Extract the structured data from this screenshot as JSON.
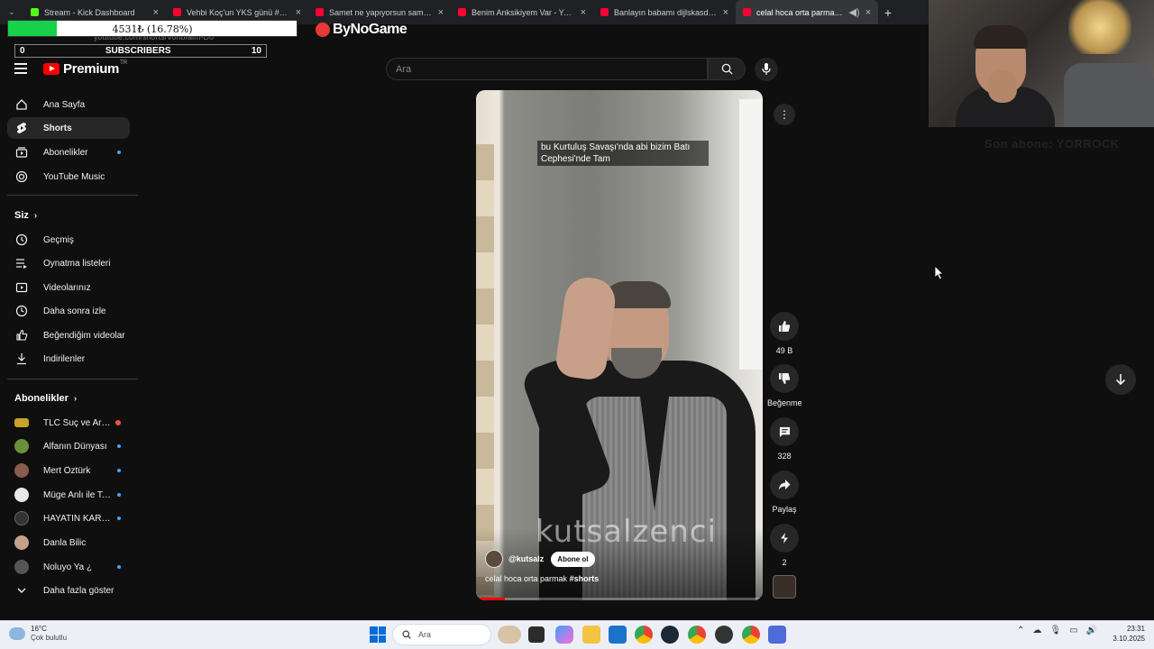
{
  "browser": {
    "tabs": [
      {
        "label": "Stream - Kick Dashboard",
        "favicon_color": "#53fc18",
        "active": false
      },
      {
        "label": "Vehbi Koç'un YKS günü #yks #",
        "favicon_color": "#ff0033",
        "active": false
      },
      {
        "label": "Samet ne yapıyorsun sameTTT",
        "favicon_color": "#ff0033",
        "active": false
      },
      {
        "label": "Benim Anksikiyem Var - YouTub",
        "favicon_color": "#ff0033",
        "active": false
      },
      {
        "label": "Banlayın babamı dijlskasd - You",
        "favicon_color": "#ff0033",
        "active": false
      },
      {
        "label": "celal hoca orta parmak #sh",
        "favicon_color": "#ff0033",
        "active": true
      }
    ],
    "new_tab": "+",
    "url": "youtube.com/shorts/VohbIaim-D0"
  },
  "overlay": {
    "sub_goal_text": "4531₺ (16.78%)",
    "sub_goal_fraction": 0.1678,
    "subs_left": "0",
    "subs_label": "SUBSCRIBERS",
    "subs_right": "10",
    "sponsor": "ByNoGame",
    "cam_caption": "Son abone: YORROCK"
  },
  "youtube": {
    "logo_text": "Premium",
    "logo_region": "TR",
    "search_placeholder": "Ara"
  },
  "sidebar": {
    "main": [
      {
        "label": "Ana Sayfa",
        "icon": "home-icon"
      },
      {
        "label": "Shorts",
        "icon": "shorts-icon",
        "active": true
      },
      {
        "label": "Abonelikler",
        "icon": "subscriptions-icon",
        "dot": true
      },
      {
        "label": "YouTube Music",
        "icon": "music-icon"
      }
    ],
    "you_heading": "Siz",
    "you": [
      {
        "label": "Geçmiş",
        "icon": "history-icon"
      },
      {
        "label": "Oynatma listeleri",
        "icon": "playlist-icon"
      },
      {
        "label": "Videolarınız",
        "icon": "your-videos-icon"
      },
      {
        "label": "Daha sonra izle",
        "icon": "watch-later-icon"
      },
      {
        "label": "Beğendiğim videolar",
        "icon": "liked-icon"
      },
      {
        "label": "İndirilenler",
        "icon": "download-icon"
      }
    ],
    "subs_heading": "Abonelikler",
    "subscriptions": [
      {
        "label": "TLC Suç ve Araşt...",
        "avatar_color": "#c9a227",
        "live": true
      },
      {
        "label": "Alfanın Dünyası",
        "avatar_color": "#6b8f3a",
        "dot": true
      },
      {
        "label": "Mert Öztürk",
        "avatar_color": "#8a5a4a",
        "dot": true
      },
      {
        "label": "Müge Anlı ile Tatl...",
        "avatar_color": "#e8e8e8",
        "dot": true
      },
      {
        "label": "HAYATIN KARAN...",
        "avatar_color": "#333333",
        "dot": true
      },
      {
        "label": "Danla Bilic",
        "avatar_color": "#c7a08a",
        "dot": false
      },
      {
        "label": "Noluyo Ya ¿",
        "avatar_color": "#555555",
        "dot": true
      }
    ],
    "show_more": "Daha fazla göster"
  },
  "short": {
    "caption": "bu Kurtuluş Savaşı'nda abi bizim Batı Cephesi'nde Tam",
    "watermark": "kutsalzenci",
    "channel": "@kutsalz",
    "subscribe_label": "Abone ol",
    "title_text": "celal hoca orta parmak",
    "title_tag": "#shorts",
    "progress": 0.1,
    "actions": {
      "likes": "49 B",
      "dislike_label": "Beğenme",
      "comments": "328",
      "share_label": "Paylaş",
      "remix_count": "2"
    }
  },
  "taskbar": {
    "weather_temp": "16°C",
    "weather_desc": "Çok bulutlu",
    "search_placeholder": "Ara",
    "time": "23:31",
    "date": "3.10.2025"
  }
}
